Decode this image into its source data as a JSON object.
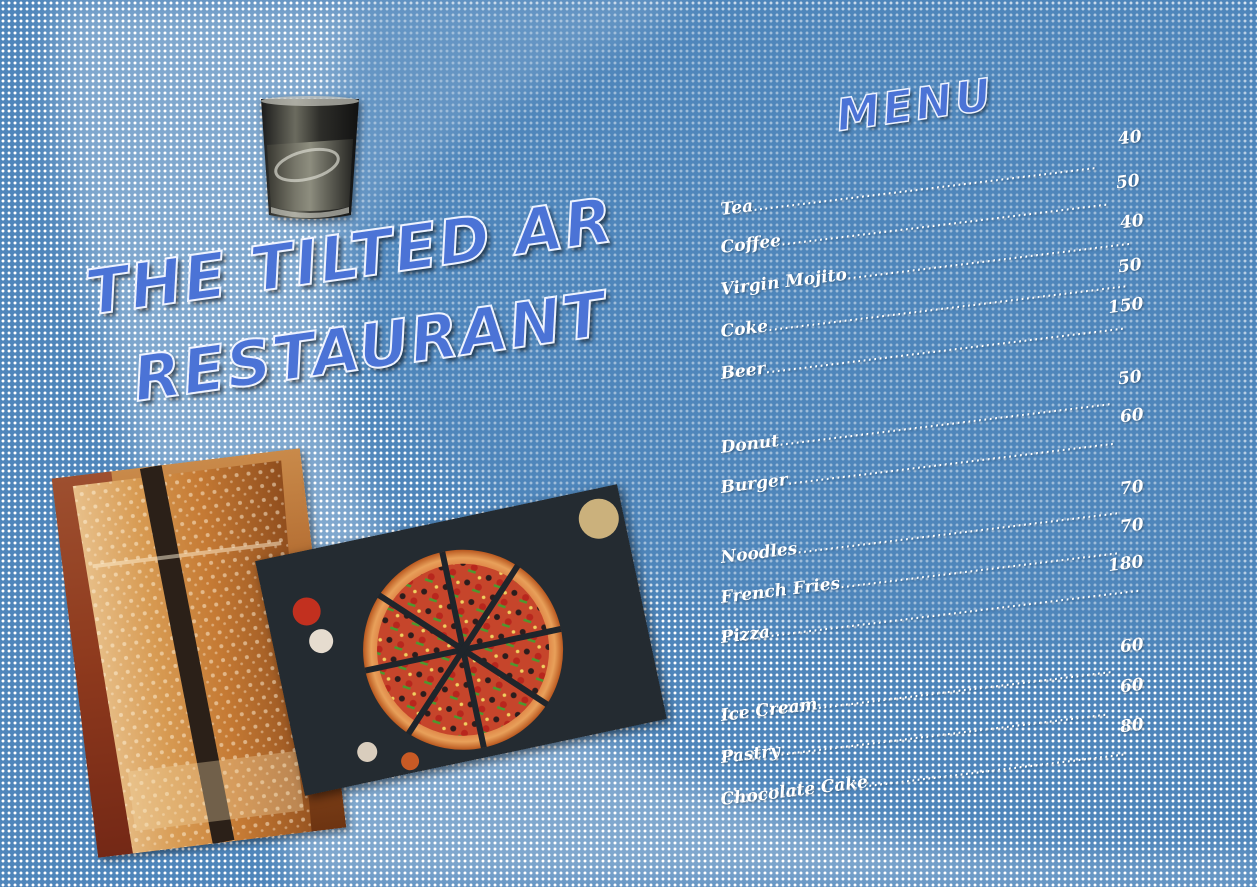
{
  "title": {
    "line1": "THE TILTED AR",
    "line2": "RESTAURANT"
  },
  "menu": {
    "heading": "MENU",
    "items": [
      {
        "name": "Tea",
        "price": "40"
      },
      {
        "name": "Coffee",
        "price": "50"
      },
      {
        "name": "Virgin Mojito",
        "price": "40"
      },
      {
        "name": "Coke",
        "price": "50"
      },
      {
        "name": "Beer",
        "price": "150"
      },
      {
        "name": "Donut",
        "price": "50"
      },
      {
        "name": "Burger",
        "price": "60"
      },
      {
        "name": "Noodles",
        "price": "70"
      },
      {
        "name": "French Fries",
        "price": "70"
      },
      {
        "name": "Pizza",
        "price": "180"
      },
      {
        "name": "Ice Cream",
        "price": "60"
      },
      {
        "name": "Pastry",
        "price": "60"
      },
      {
        "name": "Chocolate Cake",
        "price": "80"
      }
    ]
  },
  "colors": {
    "background": "#4f86bb",
    "title_fill": "#4b73d6",
    "text": "#ffffff"
  }
}
